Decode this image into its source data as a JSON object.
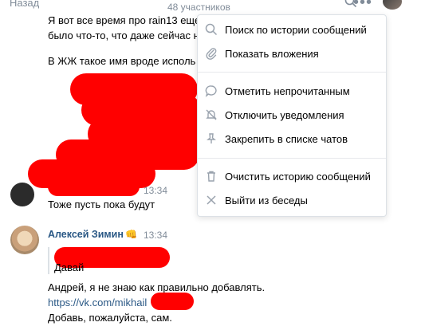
{
  "header": {
    "back_label": "Назад",
    "members": "48 участников"
  },
  "messages": {
    "line1": "Я вот все время про rain13 еще",
    "line2": "было что-то, что даже сейчас н",
    "line3": "В ЖЖ такое имя вроде исполь",
    "msg2_time": "13:34",
    "msg2_text": "Тоже пусть пока будут",
    "msg3_author": "Алексей Зимин",
    "msg3_emoji": "👊",
    "msg3_time": "13:34",
    "msg3_quote": "Давай",
    "msg3_line1": "Андрей, я не знаю как правильно добавлять.",
    "msg3_link": "https://vk.com/mikhail",
    "msg3_line2": "Добавь, пожалуйста, сам."
  },
  "menu": {
    "items": [
      {
        "label": "Поиск по истории сообщений",
        "icon": "search-icon"
      },
      {
        "label": "Показать вложения",
        "icon": "paperclip-icon"
      },
      {
        "label": "Отметить непрочитанным",
        "icon": "chat-bubble-icon"
      },
      {
        "label": "Отключить уведомления",
        "icon": "bell-off-icon"
      },
      {
        "label": "Закрепить в списке чатов",
        "icon": "pin-icon"
      },
      {
        "label": "Очистить историю сообщений",
        "icon": "trash-icon"
      },
      {
        "label": "Выйти из беседы",
        "icon": "close-icon"
      }
    ]
  },
  "colors": {
    "link": "#2a5885",
    "muted": "#818c99",
    "redaction": "#ff0000"
  }
}
